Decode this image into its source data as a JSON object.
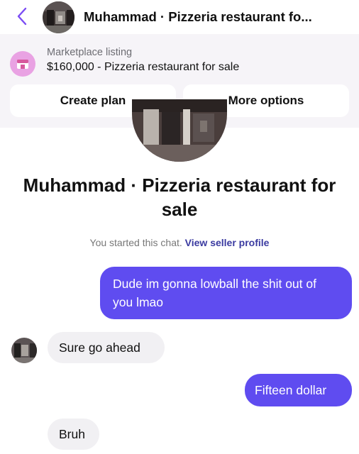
{
  "header": {
    "title": "Muhammad · Pizzeria restaurant fo..."
  },
  "listing": {
    "label": "Marketplace listing",
    "title": "$160,000 - Pizzeria restaurant for sale"
  },
  "actions": {
    "create_plan": "Create plan",
    "more_options": "More options"
  },
  "conversation": {
    "title": "Muhammad · Pizzeria restaurant for sale",
    "started_text": "You started this chat.",
    "view_profile_link": "View seller profile"
  },
  "messages": [
    {
      "sender": "me",
      "text": "Dude im gonna lowball the shit out of you lmao"
    },
    {
      "sender": "seller",
      "text": "Sure go ahead"
    },
    {
      "sender": "me",
      "text": "Fifteen dollar"
    },
    {
      "sender": "seller",
      "text": "Bruh"
    }
  ],
  "colors": {
    "accent": "#5f4cf0",
    "back_arrow": "#7b4cf4",
    "marketplace_icon": "#e9a2e3",
    "panel_bg": "#f6f4f8",
    "incoming_bubble": "#f1f0f3"
  },
  "icons": {
    "back": "chevron-left-icon",
    "marketplace": "storefront-icon"
  }
}
